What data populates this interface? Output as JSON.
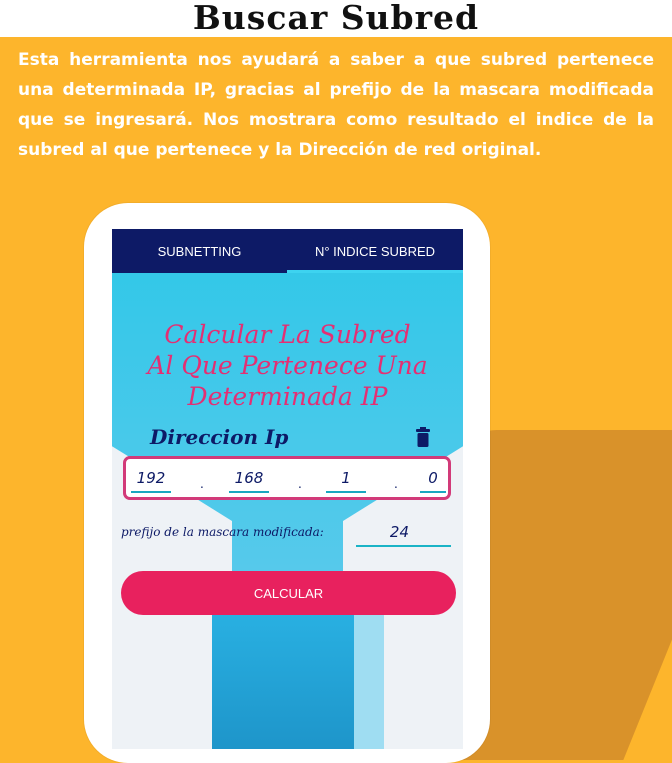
{
  "header": {
    "title": "Buscar Subred",
    "description": "Esta herramienta nos ayudará a saber a que subred pertenece una determinada IP, gracias al prefijo de la mascara modificada que se ingresará. Nos mostrara como resultado el indice de la subred al que pertenece y  la Dirección de red original."
  },
  "app": {
    "tabs": [
      {
        "label": "SUBNETTING",
        "active": false
      },
      {
        "label": "N° INDICE SUBRED",
        "active": true
      }
    ],
    "hero_title_lines": [
      "Calcular La Subred",
      "Al Que Pertenece Una",
      "Determinada IP"
    ],
    "ip_section_label": "Direccion Ip",
    "ip_octets": [
      "192",
      "168",
      "1",
      "0"
    ],
    "ip_separator": ".",
    "prefix_label": "prefijo de la mascara modificada:",
    "prefix_value": "24",
    "calculate_label": "CALCULAR",
    "icons": {
      "clear": "trash-icon"
    },
    "colors": {
      "appbar": "#0D1A66",
      "accent_pink": "#E42F73",
      "button": "#E8215E",
      "background": "#FDB52C"
    }
  }
}
